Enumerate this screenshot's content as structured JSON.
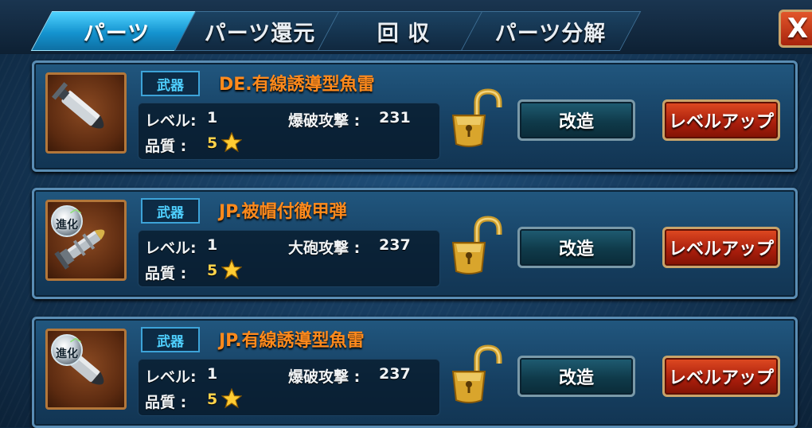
{
  "tabs": [
    {
      "label": "パーツ",
      "active": true
    },
    {
      "label": "パーツ還元",
      "active": false
    },
    {
      "label": "回 収",
      "active": false
    },
    {
      "label": "パーツ分解",
      "active": false
    }
  ],
  "close_label": "X",
  "labels": {
    "level": "レベル:",
    "quality": "品質 :"
  },
  "parts": [
    {
      "category": "武器",
      "name": "DE.有線誘導型魚雷",
      "level": "1",
      "stat_label": "爆破攻撃 :",
      "stat_value": "231",
      "quality": "5",
      "icon": "torpedo-icon",
      "evolved": false,
      "evo_label": "",
      "modify_label": "改造",
      "levelup_label": "レベルアップ"
    },
    {
      "category": "武器",
      "name": "JP.被帽付徹甲弾",
      "level": "1",
      "stat_label": "大砲攻撃 :",
      "stat_value": "237",
      "quality": "5",
      "icon": "armor-piercing-shell-icon",
      "evolved": true,
      "evo_label": "進化",
      "modify_label": "改造",
      "levelup_label": "レベルアップ"
    },
    {
      "category": "武器",
      "name": "JP.有線誘導型魚雷",
      "level": "1",
      "stat_label": "爆破攻撃 :",
      "stat_value": "237",
      "quality": "5",
      "icon": "torpedo-icon",
      "evolved": true,
      "evo_label": "進化",
      "modify_label": "改造",
      "levelup_label": "レベルアップ"
    }
  ],
  "colors": {
    "name_orange": "#ff8a1c",
    "badge_cyan": "#4fd0ff",
    "star_gold": "#ffd34a",
    "tab_active": "#1493cf",
    "levelup_red": "#a81d0c"
  }
}
